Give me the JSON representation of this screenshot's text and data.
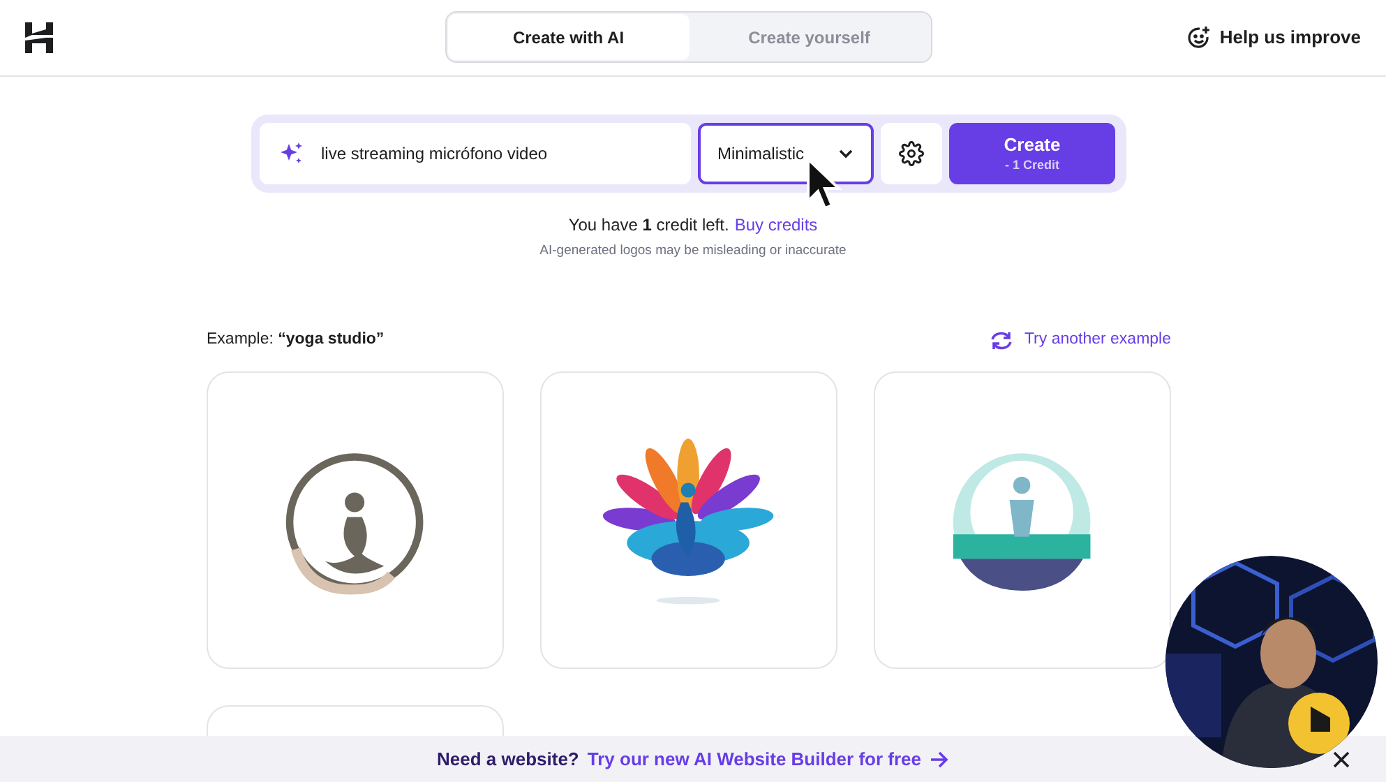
{
  "header": {
    "tabs": [
      {
        "label": "Create with AI",
        "selected": true
      },
      {
        "label": "Create yourself",
        "selected": false
      }
    ],
    "help": "Help us improve"
  },
  "prompt": {
    "value": "live streaming micrófono video",
    "style": "Minimalistic",
    "create": "Create",
    "cost": "- 1 Credit"
  },
  "credits": {
    "text": "You have **1** credit left.",
    "link": "Buy credits",
    "note": "AI-generated logos may be misleading or inaccurate"
  },
  "examples": {
    "label": "Example: **“yoga studio”**",
    "action": "Try another example",
    "cards": [
      {
        "kind": "picture"
      },
      {
        "kind": "picture"
      },
      {
        "kind": "picture"
      },
      {
        "kind": "empty"
      }
    ]
  },
  "banner": {
    "question": "Need a website?",
    "link": "Try our new AI Website Builder for free"
  },
  "webcam": {
    "kind": "picture"
  }
}
